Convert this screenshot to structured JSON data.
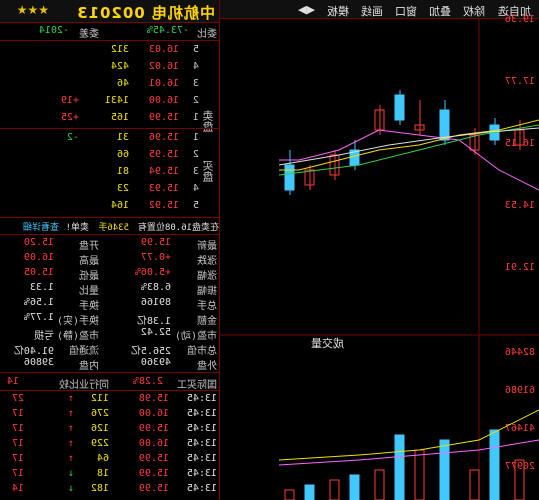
{
  "header": {
    "title": "中航机电 002013",
    "stars": "★★★"
  },
  "committee": {
    "label_ratio": "委比",
    "ratio": "-73.45%",
    "label_diff": "委差",
    "diff": "-2014"
  },
  "sell_label": "卖盘",
  "buy_label": "买盘",
  "sell_orders": [
    {
      "lvl": "5",
      "price": "16.03",
      "vol": "312",
      "delta": ""
    },
    {
      "lvl": "4",
      "price": "16.02",
      "vol": "424",
      "delta": ""
    },
    {
      "lvl": "3",
      "price": "16.01",
      "vol": "46",
      "delta": ""
    },
    {
      "lvl": "2",
      "price": "16.00",
      "vol": "1431",
      "delta": "+19"
    },
    {
      "lvl": "1",
      "price": "15.99",
      "vol": "165",
      "delta": "+25"
    }
  ],
  "buy_orders": [
    {
      "lvl": "1",
      "price": "15.96",
      "vol": "31",
      "delta": "-2"
    },
    {
      "lvl": "2",
      "price": "15.95",
      "vol": "66",
      "delta": ""
    },
    {
      "lvl": "3",
      "price": "15.94",
      "vol": "81",
      "delta": ""
    },
    {
      "lvl": "4",
      "price": "15.93",
      "vol": "23",
      "delta": ""
    },
    {
      "lvl": "5",
      "price": "15.92",
      "vol": "164",
      "delta": ""
    }
  ],
  "warn_line": {
    "a": "在卖盘16.08位置有",
    "b": "5346手",
    "c": "卖单!",
    "d": "查看详细"
  },
  "stats_left": [
    {
      "label": "最新",
      "value": "15.99"
    },
    {
      "label": "涨跌",
      "value": "+0.77"
    },
    {
      "label": "涨幅",
      "value": "+5.06%"
    },
    {
      "label": "振幅",
      "value": "6.83%"
    },
    {
      "label": "总手",
      "value": "89166"
    },
    {
      "label": "金额",
      "value": "1.38亿"
    },
    {
      "label": "市盈(动)",
      "value": "52.42"
    },
    {
      "label": "总市值",
      "value": "256.5亿"
    },
    {
      "label": "外盘",
      "value": "49360"
    }
  ],
  "stats_right": [
    {
      "label": "开盘",
      "value": "15.20"
    },
    {
      "label": "最高",
      "value": "16.09"
    },
    {
      "label": "最低",
      "value": "15.05"
    },
    {
      "label": "量比",
      "value": "1.33"
    },
    {
      "label": "换手",
      "value": "1.56%"
    },
    {
      "label": "换手(实)",
      "value": "1.77%"
    },
    {
      "label": "市盈(静)",
      "value": "亏损"
    },
    {
      "label": "流通值",
      "value": "91.40亿"
    },
    {
      "label": "内盘",
      "value": "39806"
    }
  ],
  "ticks_header": {
    "label": "国际买工",
    "value": "2.28%",
    "compare": "同行业比较",
    "num": "14"
  },
  "ticks": [
    {
      "time": "13:45",
      "price": "15.98",
      "vol": "112",
      "dir": "up",
      "cnt": "27"
    },
    {
      "time": "13:45",
      "price": "16.00",
      "vol": "276",
      "dir": "up",
      "cnt": "17"
    },
    {
      "time": "13:45",
      "price": "15.99",
      "vol": "126",
      "dir": "up",
      "cnt": "17"
    },
    {
      "time": "13:45",
      "price": "16.00",
      "vol": "229",
      "dir": "up",
      "cnt": "17"
    },
    {
      "time": "13:45",
      "price": "15.99",
      "vol": "64",
      "dir": "up",
      "cnt": "17"
    },
    {
      "time": "13:45",
      "price": "15.99",
      "vol": "18",
      "dir": "down",
      "cnt": "17"
    },
    {
      "time": "13:45",
      "price": "15.99",
      "vol": "182",
      "dir": "down",
      "cnt": "14"
    }
  ],
  "toolbar": {
    "tabs": [
      "加自选",
      "除权",
      "叠加",
      "窗口",
      "画线",
      "模板",
      "◀▶"
    ]
  },
  "price_axis": [
    "19.36",
    "17.77",
    "16.15",
    "14.53",
    "12.91"
  ],
  "vol_axis": [
    "82446",
    "61986",
    "41467",
    "20977",
    "X10"
  ],
  "vol_label": "成交量",
  "colors": {
    "bg": "#000000",
    "grid": "#770000",
    "up": "#ff3b3b",
    "down": "#40c8ff",
    "title": "#ffd400"
  }
}
